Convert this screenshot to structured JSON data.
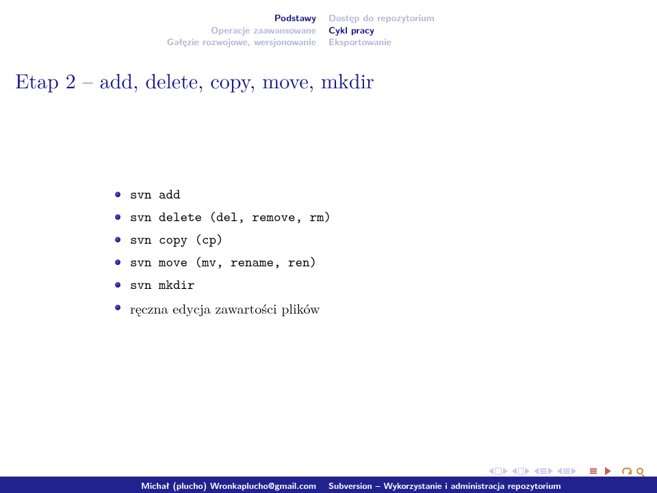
{
  "header": {
    "left": {
      "line1": "Podstawy",
      "line2": "Operacje zaawansowane",
      "line3": "Gałęzie rozwojowe, wersjonowanie"
    },
    "right": {
      "line1": "Dostęp do repozytorium",
      "line2": "Cykl pracy",
      "line3": "Eksportowanie"
    }
  },
  "frametitle": "Etap 2 – add, delete, copy, move, mkdir",
  "bullets": [
    "svn add",
    "svn delete (del, remove, rm)",
    "svn copy (cp)",
    "svn move (mv, rename, ren)",
    "svn mkdir",
    "ręczna edycja zawartości plików"
  ],
  "footer": {
    "author": "Michał (plucho) Wronkaplucho@gmail.com",
    "title": "Subversion – Wykorzystanie i administracja repozytorium"
  }
}
